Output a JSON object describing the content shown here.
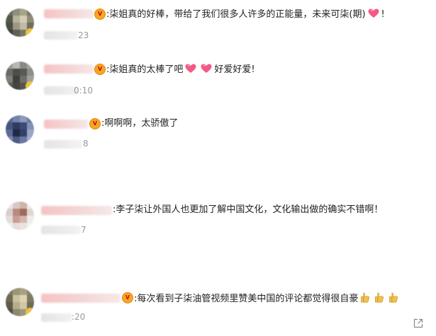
{
  "comments": [
    {
      "text": ":柒姐真的好棒，带给了我们很多人许多的正能量，未来可柒(期)",
      "tail": "!",
      "time": "23"
    },
    {
      "text": ":柒姐真的太棒了吧",
      "tail": "好爱好爱!",
      "time": "0:10"
    },
    {
      "text": ":啊啊啊，太骄傲了",
      "time": "8"
    },
    {
      "text": ":李子柒让外国人也更加了解中国文化，文化输出做的确实不错啊！",
      "time": "7"
    },
    {
      "text": ":每次看到子柒油管视频里赞美中国的评论都觉得很自豪",
      "time": ":20"
    }
  ],
  "colors": {
    "text": "#222222",
    "time": "#999999",
    "name_blur": "#f6c3c3",
    "heart": "#f25a86",
    "thumb": "#f2c14e",
    "crown": "#f5a623"
  },
  "icons": [
    "crown-badge-icon",
    "pink-heart-icon",
    "thumbs-up-icon",
    "share-icon"
  ]
}
